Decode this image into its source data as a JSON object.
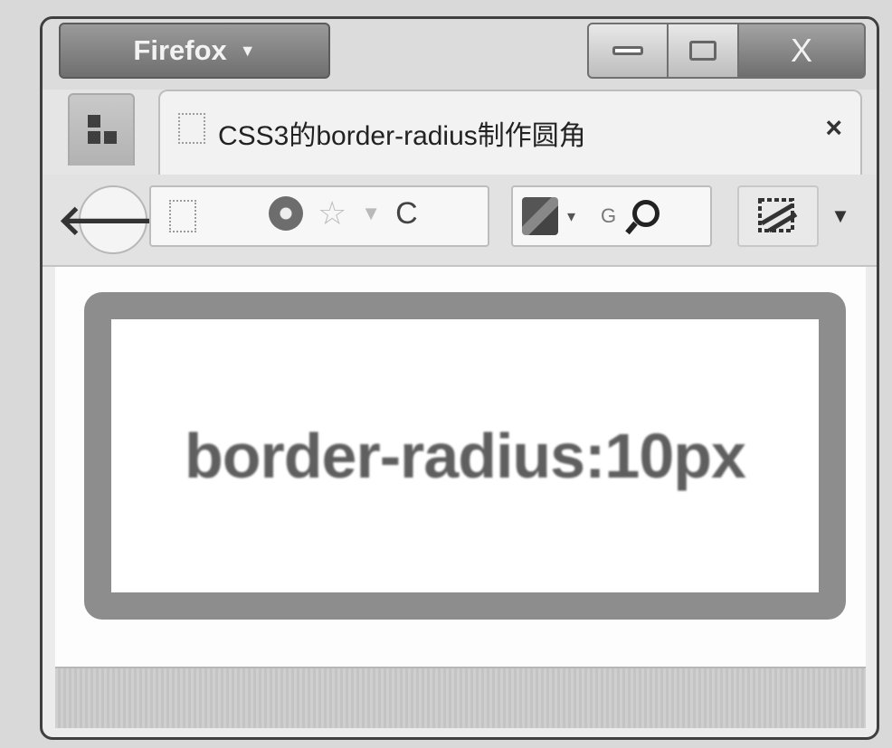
{
  "window": {
    "app_menu_label": "Firefox",
    "app_menu_caret": "▼",
    "close_glyph": "X"
  },
  "tabs": [
    {
      "title": "CSS3的border-radius制作圆角",
      "close_glyph": "×"
    }
  ],
  "navbar": {
    "back_glyph": "🡐",
    "reload_glyph": "C",
    "star_glyph": "☆",
    "dropdown_glyph": "▼",
    "search_engine_label": "G",
    "search_caret": "▾",
    "menu_arrow": "▼"
  },
  "content": {
    "demo_text": "border-radius:10px"
  },
  "colors": {
    "border_box": "#8d8d8d",
    "demo_text": "#5f5f5f",
    "chrome": "#e2e2e2"
  },
  "icons": [
    "grid-icon",
    "back-arrow-icon",
    "page-icon",
    "globe-icon",
    "star-icon",
    "reload-icon",
    "search-engine-icon",
    "magnifier-icon",
    "addon-icon"
  ]
}
